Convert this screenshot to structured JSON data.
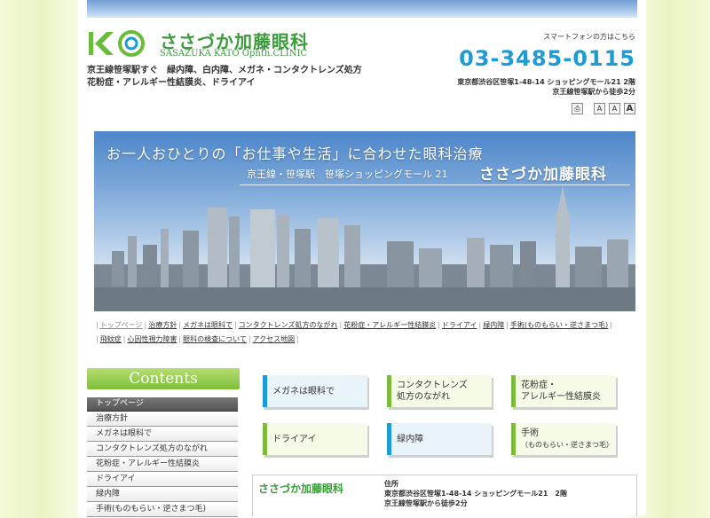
{
  "header": {
    "clinic_name_jp": "ささづか加藤眼科",
    "clinic_name_en": "SASAZUKA KATO Ophth.CLINIC",
    "tagline_line1": "京王線笹塚駅すぐ　緑内障、白内障、メガネ・コンタクトレンズ処方",
    "tagline_line2": "花粉症・アレルギー性結膜炎、ドライアイ",
    "smartphone_link": "スマートフォンの方はこちら",
    "phone": "03-3485-0115",
    "address_line1": "東京都渋谷区笹塚1-48-14 ショッピングモール21 2階",
    "address_line2": "京王線笹塚駅から徒歩2分",
    "font_buttons": [
      "A",
      "A",
      "A"
    ]
  },
  "hero": {
    "line1": "お一人おひとりの「お仕事や生活」に合わせた眼科治療",
    "line2": "京王線・笹塚駅　笹塚ショッピングモール 21",
    "name": "ささづか加藤眼科"
  },
  "nav_links": [
    "トップページ",
    "治療方針",
    "メガネは眼科で",
    "コンタクトレンズ処方のながれ",
    "花粉症・アレルギー性結膜炎",
    "ドライアイ",
    "緑内障",
    "手術(ものもらい・逆さまつ毛)",
    "飛蚊症",
    "心因性視力障害",
    "眼科の検査について",
    "アクセス地図"
  ],
  "sidebar": {
    "title": "Contents",
    "items": [
      "トップページ",
      "治療方針",
      "メガネは眼科で",
      "コンタクトレンズ処方のながれ",
      "花粉症・アレルギー性結膜炎",
      "ドライアイ",
      "緑内障",
      "手術(ものもらい・逆さまつ毛)"
    ]
  },
  "tiles": [
    {
      "line1": "メガネは眼科で",
      "line2": ""
    },
    {
      "line1": "コンタクトレンズ",
      "line2": "処方のながれ"
    },
    {
      "line1": "花粉症・",
      "line2": "アレルギー性結膜炎"
    },
    {
      "line1": "ドライアイ",
      "line2": ""
    },
    {
      "line1": "緑内障",
      "line2": ""
    },
    {
      "line1": "手術",
      "line2": "（ものもらい・逆さまつ毛）"
    }
  ],
  "info": {
    "name": "ささづか加藤眼科",
    "label": "住所",
    "address": "東京都渋谷区笹塚1-48-14 ショッピングモール21　2階",
    "access": "京王線笹塚駅から徒歩2分"
  },
  "colors": {
    "brand_green": "#3a9b3a",
    "phone_blue": "#1b9bd7",
    "tile_green": "#7dbb3c"
  }
}
